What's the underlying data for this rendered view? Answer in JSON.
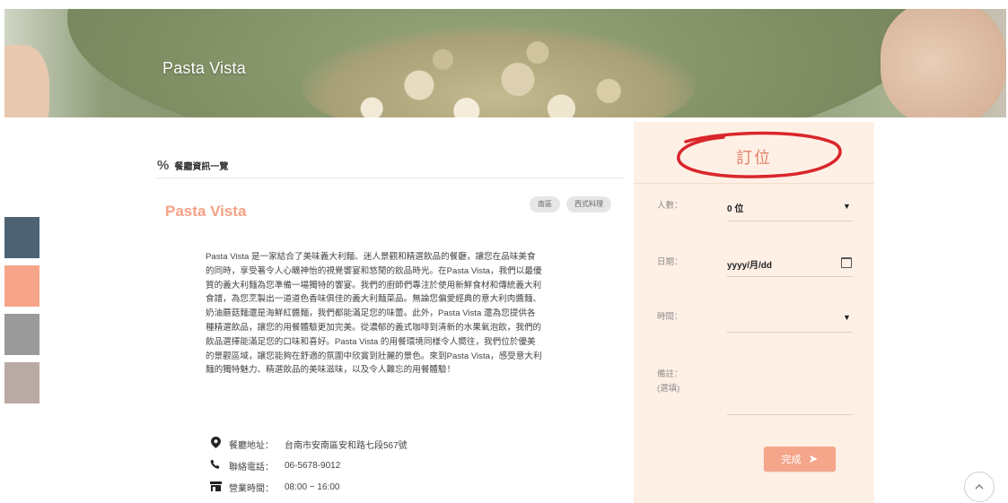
{
  "hero": {
    "title": "Pasta Vista"
  },
  "swatches": [
    "#4d6374",
    "#f7a58a",
    "#9a9a9a",
    "#b9aaa4"
  ],
  "section": {
    "icon": "percent-icon",
    "title": "餐廳資訊一覽"
  },
  "restaurant": {
    "name": "Pasta Vista",
    "tags": [
      "南區",
      "西式料理"
    ],
    "description": "Pasta Vista 是一家結合了美味義大利麵、迷人景觀和精選飲品的餐廳，讓您在品味美食的同時，享受著令人心曠神怡的視覺饗宴和悠閒的飲品時光。在Pasta Vista，我們以最優質的義大利麵為您準備一場獨特的饗宴。我們的廚師們專注於使用新鮮食材和傳統義大利食譜，為您烹製出一道道色香味俱佳的義大利麵菜品。無論您偏愛經典的意大利肉醬麵、奶油蘑菇麵還是海鮮紅醬麵，我們都能滿足您的味蕾。此外，Pasta Vista 還為您提供各種精選飲品，讓您的用餐體驗更加完美。從濃郁的義式咖啡到清新的水果氣泡飲，我們的飲品選擇能滿足您的口味和喜好。Pasta Vista 的用餐環境同樣令人嚮往，我們位於優美的景觀區域，讓您能夠在舒適的氛圍中欣賞到壯麗的景色。來到Pasta Vista，感受意大利麵的獨特魅力、精選飲品的美味滋味，以及令人難忘的用餐體驗！",
    "address_label": "餐廳地址：",
    "address": "台南市安南區安和路七段567號",
    "phone_label": "聯絡電話：",
    "phone": "06-5678-9012",
    "hours_label": "營業時間：",
    "hours": "08:00 ~ 16:00",
    "icons": {
      "address": "location-pin-icon",
      "phone": "phone-icon",
      "hours": "store-icon"
    }
  },
  "booking": {
    "title": "訂位",
    "people_label": "人數：",
    "people_value": "0 位",
    "date_label": "日期：",
    "date_value": "yyyy/月/dd",
    "time_label": "時間：",
    "time_value": "",
    "note_label": "備註：",
    "note_optional": "(選填)",
    "submit_label": "完成",
    "accent": "#f5a58a",
    "annotation_color": "#d9262b"
  },
  "scroll_top_icon": "chevron-up-icon"
}
